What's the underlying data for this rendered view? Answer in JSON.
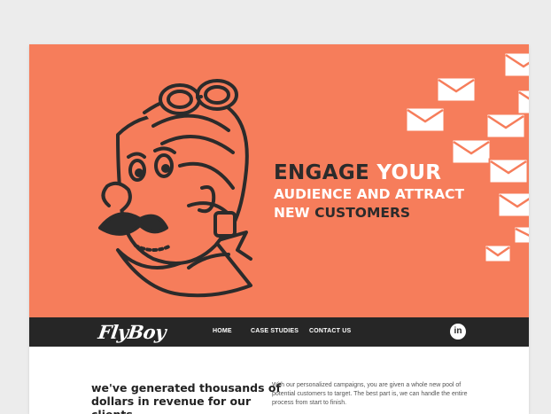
{
  "colors": {
    "hero_bg": "#f67d5b",
    "nav_bg": "#262626",
    "dark_text": "#2b2b2b",
    "light_text": "#ffffff"
  },
  "hero": {
    "headline": {
      "line1_dark": "ENGAGE",
      "line1_light": "YOUR",
      "line2": "AUDIENCE AND ATTRACT",
      "line3_light": "NEW",
      "line3_dark": "CUSTOMERS"
    },
    "mascot_icon": "aviator-mascot-illustration",
    "envelope_icon": "envelope-icon"
  },
  "nav": {
    "logo": "FlyBoy",
    "items": [
      {
        "label": "HOME"
      },
      {
        "label": "CASE STUDIES"
      },
      {
        "label": "CONTACT US"
      }
    ],
    "social_icon": "linkedin-icon",
    "social_label": "in"
  },
  "content": {
    "heading": "we've generated thousands of dollars in revenue for our clients",
    "paragraph": "With our personalized campaigns, you are given a whole new pool of potential customers to target. The best part is, we can handle the entire process from start to finish."
  }
}
